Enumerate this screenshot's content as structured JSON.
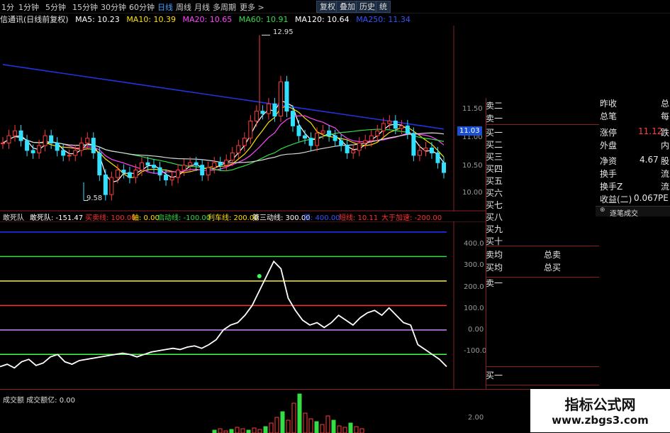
{
  "toolbar": {
    "timeframes": [
      "1分",
      "1分钟",
      "5分钟",
      "15分钟",
      "30分钟",
      "60分钟",
      "日线",
      "周线",
      "月线",
      "多周期",
      "更多 >"
    ],
    "active_timeframe_index": 6,
    "buttons": [
      "复权",
      "叠加",
      "历史",
      "统"
    ]
  },
  "ma_header": {
    "title": "信通讯(日线前复权)",
    "items": [
      {
        "label": "MA5: 10.23",
        "color": "#ffffff"
      },
      {
        "label": "MA10: 10.39",
        "color": "#ffe100"
      },
      {
        "label": "MA20: 10.65",
        "color": "#ff44ff"
      },
      {
        "label": "MA60: 10.91",
        "color": "#33dd44"
      },
      {
        "label": "MA120: 10.64",
        "color": "#ffffff"
      },
      {
        "label": "MA250: 11.34",
        "color": "#3355ff"
      }
    ]
  },
  "price_chart": {
    "high_label": "12.95",
    "low_label": "9.58",
    "y_ticks": [
      "11.50",
      "11.00",
      "10.50",
      "10.00"
    ],
    "current_price": "11.03"
  },
  "indicator": {
    "name": "敢死队",
    "items": [
      {
        "label": "敢死队: -151.47",
        "color": "#ffffff"
      },
      {
        "label": "买卖线: 100.00",
        "color": "#ff3030"
      },
      {
        "label": "轴: 0.00",
        "color": "#ffe100"
      },
      {
        "label": "启动线: -100.00",
        "color": "#33dd44"
      },
      {
        "label": "利车线: 200.00",
        "color": "#ffe100"
      },
      {
        "label": "第三动线: 300.00",
        "color": "#ffffff"
      },
      {
        "label": "买: 400.00",
        "color": "#3355ff"
      },
      {
        "label": "短线: 10.11",
        "color": "#ff3030"
      },
      {
        "label": "大于加速: -200.00",
        "color": "#ff3030"
      }
    ],
    "y_ticks": [
      "400.0",
      "300.0",
      "200.0",
      "100.0",
      "0.00",
      "-100.0"
    ]
  },
  "volume": {
    "header": "成交额  成交额亿: 0.00",
    "y_tick": "2.00"
  },
  "order_book": {
    "sell": [
      "卖二",
      "卖一"
    ],
    "buy_side": [
      "买一",
      "买二",
      "买三",
      "买四",
      "买五",
      "买六",
      "买七",
      "买八",
      "买九",
      "买十"
    ],
    "avg_sell": "卖均",
    "avg_buy": "买均",
    "total_sell": "总卖",
    "total_buy": "总买",
    "sell1_again": "卖一",
    "buy1_bottom": "买一"
  },
  "info_panel": {
    "rows": [
      {
        "label": "昨收",
        "value": "",
        "extra": "总"
      },
      {
        "label": "总笔",
        "value": "",
        "extra": "每"
      },
      {
        "label": "涨停",
        "value": "11.12",
        "extra": "跌"
      },
      {
        "label": "外盘",
        "value": "",
        "extra": "内"
      },
      {
        "label": "净资",
        "value": "4.67",
        "extra": "股"
      },
      {
        "label": "换手",
        "value": "",
        "extra": "流"
      },
      {
        "label": "换手Z",
        "value": "",
        "extra": "流"
      },
      {
        "label": "收益(二)",
        "value": "0.067",
        "extra": "PE"
      }
    ],
    "tick_link": "逐笔成交"
  },
  "watermark": {
    "title": "指标公式网",
    "url": "www.zbgs3.com"
  },
  "chart_data": {
    "type": "line",
    "price_close": [
      10.75,
      10.9,
      11.0,
      10.8,
      10.6,
      10.55,
      10.7,
      10.9,
      10.75,
      10.6,
      10.5,
      10.5,
      10.6,
      10.75,
      10.85,
      10.55,
      10.1,
      9.7,
      10.05,
      10.2,
      10.15,
      10.05,
      10.2,
      10.35,
      10.3,
      10.25,
      10.1,
      10.0,
      10.05,
      10.2,
      10.3,
      10.35,
      10.3,
      10.1,
      10.25,
      10.35,
      10.3,
      10.4,
      10.55,
      10.7,
      10.85,
      11.2,
      11.4,
      11.35,
      11.55,
      11.3,
      12.0,
      11.4,
      11.1,
      10.9,
      10.85,
      10.7,
      10.95,
      11.0,
      10.9,
      10.8,
      10.7,
      10.55,
      10.6,
      10.75,
      10.8,
      10.9,
      11.0,
      11.15,
      11.2,
      11.05,
      11.1,
      10.95,
      10.5,
      10.6,
      10.65,
      10.55,
      10.35,
      10.15
    ],
    "indicator_series": [
      -150,
      -140,
      -155,
      -130,
      -120,
      -145,
      -135,
      -110,
      -100,
      -130,
      -140,
      -125,
      -120,
      -115,
      -110,
      -105,
      -100,
      -95,
      -100,
      -110,
      -100,
      -90,
      -85,
      -80,
      -75,
      -80,
      -70,
      -65,
      -75,
      -60,
      -40,
      0,
      20,
      30,
      60,
      100,
      160,
      220,
      280,
      250,
      130,
      80,
      40,
      20,
      30,
      10,
      30,
      60,
      40,
      20,
      50,
      70,
      80,
      60,
      90,
      60,
      30,
      20,
      -60,
      -80,
      -100,
      -120,
      -150
    ],
    "reference_lines": {
      "buy_line": 400,
      "third_line": 300,
      "brake_line": 200,
      "trade_line": 100,
      "axis": 0,
      "start_line": -100
    },
    "y_range_price": [
      9.5,
      13.0
    ],
    "y_range_indicator": [
      -160,
      420
    ]
  }
}
